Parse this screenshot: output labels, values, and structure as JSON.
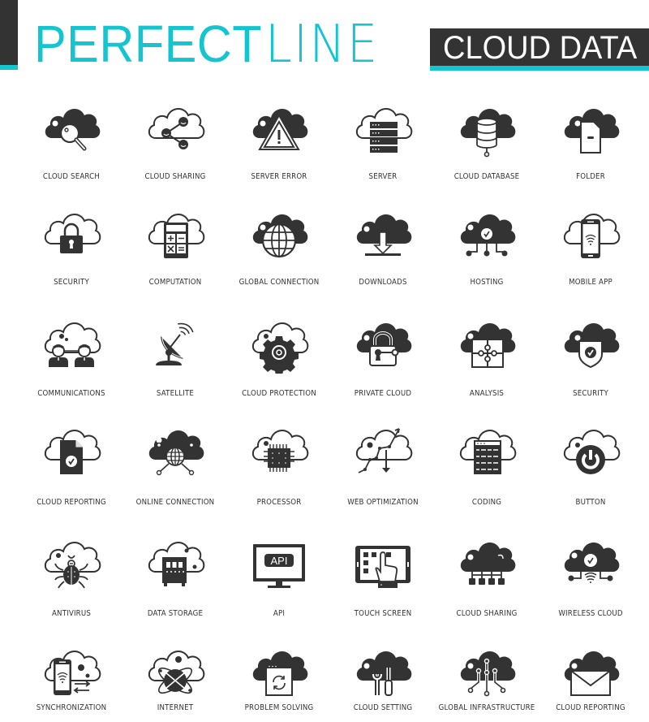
{
  "header": {
    "title_bold": "PERFECT",
    "title_thin": "LINE",
    "badge": "CLOUD DATA",
    "accent_color": "#14c4cf",
    "dark_color": "#333333"
  },
  "icons": [
    {
      "label": "CLOUD SEARCH",
      "icon": "cloud-search-icon"
    },
    {
      "label": "CLOUD SHARING",
      "icon": "cloud-sharing-icon"
    },
    {
      "label": "SERVER ERROR",
      "icon": "server-error-icon"
    },
    {
      "label": "SERVER",
      "icon": "server-icon"
    },
    {
      "label": "CLOUD DATABASE",
      "icon": "cloud-database-icon"
    },
    {
      "label": "FOLDER",
      "icon": "folder-icon"
    },
    {
      "label": "SECURITY",
      "icon": "padlock-icon"
    },
    {
      "label": "COMPUTATION",
      "icon": "calculator-icon"
    },
    {
      "label": "GLOBAL CONNECTION",
      "icon": "globe-icon"
    },
    {
      "label": "DOWNLOADS",
      "icon": "download-icon"
    },
    {
      "label": "HOSTING",
      "icon": "hosting-icon"
    },
    {
      "label": "MOBILE APP",
      "icon": "mobile-app-icon"
    },
    {
      "label": "COMMUNICATIONS",
      "icon": "communications-icon"
    },
    {
      "label": "SATELLITE",
      "icon": "satellite-dish-icon"
    },
    {
      "label": "CLOUD PROTECTION",
      "icon": "gear-icon"
    },
    {
      "label": "PRIVATE CLOUD",
      "icon": "lock-key-icon"
    },
    {
      "label": "ANALYSIS",
      "icon": "puzzle-icon"
    },
    {
      "label": "SECURITY",
      "icon": "shield-check-icon"
    },
    {
      "label": "CLOUD REPORTING",
      "icon": "document-check-icon"
    },
    {
      "label": "ONLINE CONNECTION",
      "icon": "online-connection-icon"
    },
    {
      "label": "PROCESSOR",
      "icon": "processor-chip-icon"
    },
    {
      "label": "WEB OPTIMIZATION",
      "icon": "web-optimization-icon"
    },
    {
      "label": "CODING",
      "icon": "code-window-icon"
    },
    {
      "label": "BUTTON",
      "icon": "power-button-icon"
    },
    {
      "label": "ANTIVIRUS",
      "icon": "bug-icon"
    },
    {
      "label": "DATA STORAGE",
      "icon": "data-storage-icon"
    },
    {
      "label": "API",
      "icon": "api-monitor-icon"
    },
    {
      "label": "TOUCH SCREEN",
      "icon": "touch-screen-icon"
    },
    {
      "label": "CLOUD SHARING",
      "icon": "cloud-network-icon"
    },
    {
      "label": "WIRELESS CLOUD",
      "icon": "wireless-cloud-icon"
    },
    {
      "label": "SYNCHRONIZATION",
      "icon": "sync-phone-icon"
    },
    {
      "label": "INTERNET",
      "icon": "internet-atom-icon"
    },
    {
      "label": "PROBLEM SOLVING",
      "icon": "refresh-window-icon"
    },
    {
      "label": "CLOUD SETTING",
      "icon": "tools-icon"
    },
    {
      "label": "GLOBAL INFRASTRUCTURE",
      "icon": "circuit-icon"
    },
    {
      "label": "CLOUD REPORTING",
      "icon": "envelope-icon"
    }
  ]
}
